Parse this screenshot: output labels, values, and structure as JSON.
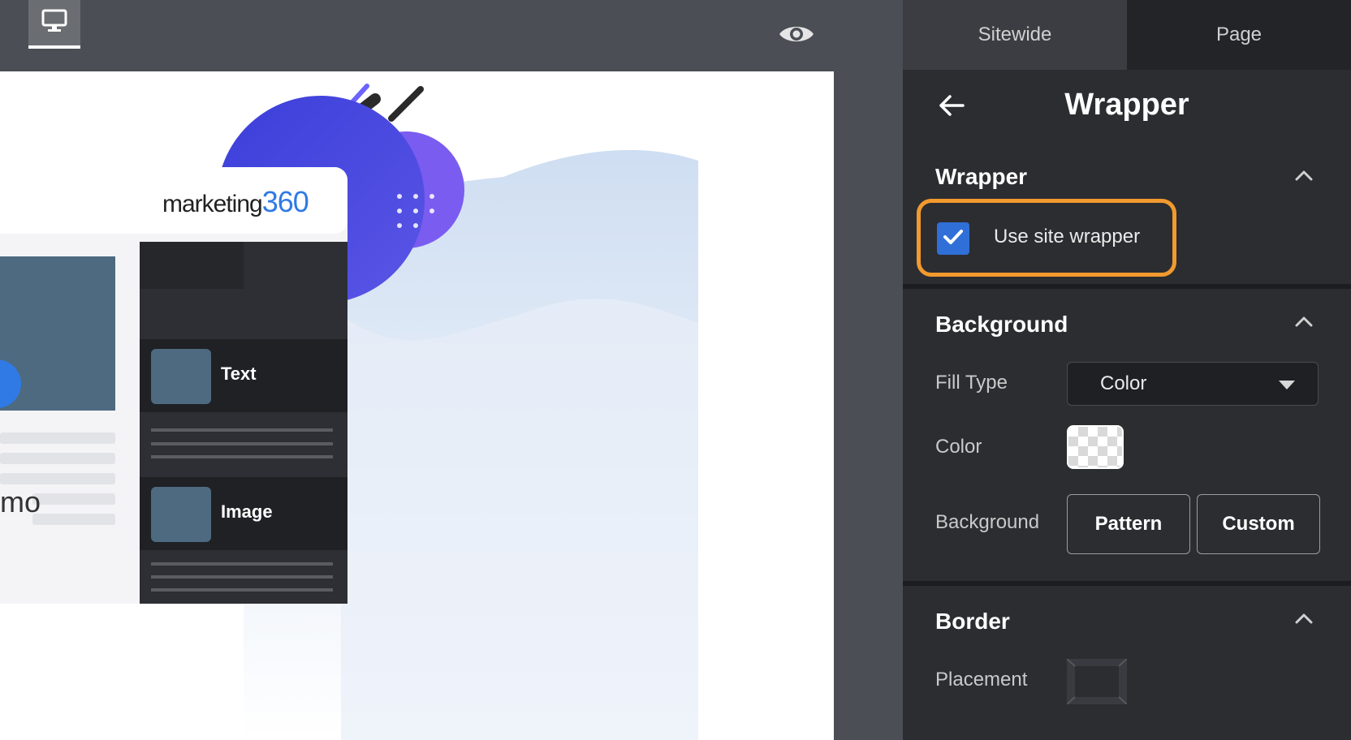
{
  "toolbar": {
    "device_icon": "desktop-monitor-icon",
    "preview_icon": "eye-icon"
  },
  "canvas": {
    "logo_text_left": "marketing",
    "logo_text_right": "360",
    "card_item_text": "Text",
    "card_item_image": "Image",
    "partial_text": "mo"
  },
  "panel": {
    "tabs": [
      "Sitewide",
      "Page"
    ],
    "title": "Wrapper",
    "back_icon": "arrow-left-icon",
    "sections": {
      "wrapper": {
        "title": "Wrapper",
        "use_site_wrapper_label": "Use site wrapper",
        "use_site_wrapper_checked": true
      },
      "background": {
        "title": "Background",
        "fill_type_label": "Fill Type",
        "fill_type_value": "Color",
        "color_label": "Color",
        "background_label": "Background",
        "pattern_button": "Pattern",
        "custom_button": "Custom"
      },
      "border": {
        "title": "Border",
        "placement_label": "Placement"
      }
    },
    "colors": {
      "highlight": "#f29a2e",
      "checkbox": "#2f6fd7"
    }
  }
}
